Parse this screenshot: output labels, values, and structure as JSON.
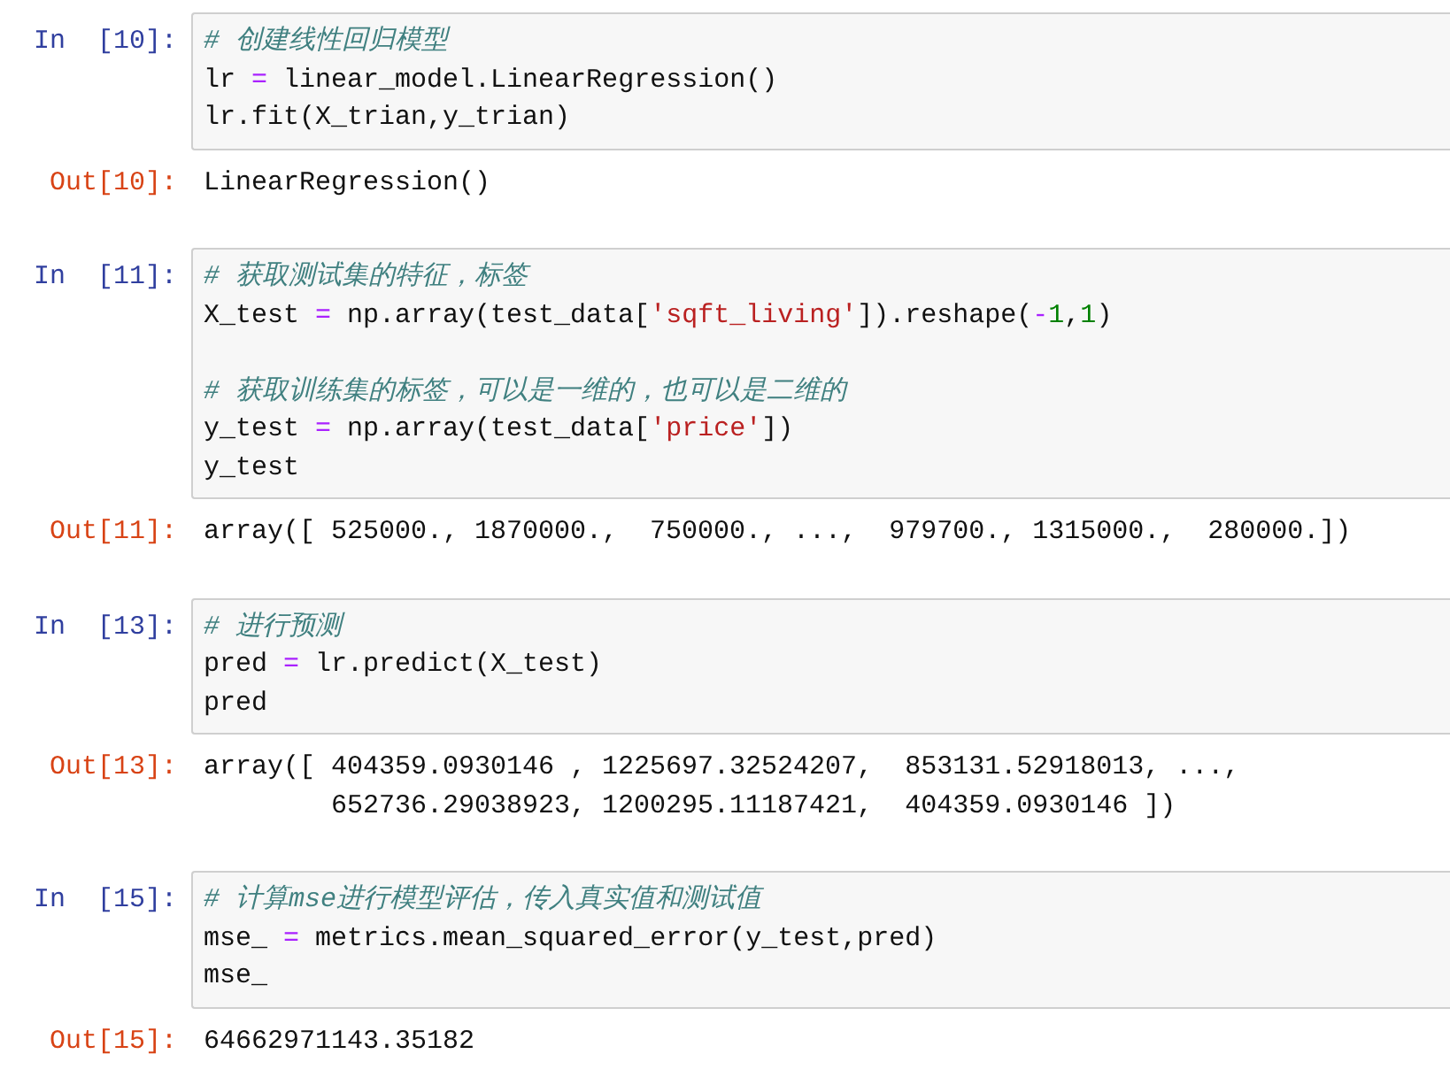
{
  "cells": [
    {
      "prompt_in": "In  [10]:",
      "lines": [
        {
          "kind": "code",
          "tokens": [
            {
              "text": "# 创建线性回归模型",
              "kind": "comment"
            }
          ]
        },
        {
          "kind": "code",
          "tokens": [
            {
              "text": "lr ",
              "kind": "plain"
            },
            {
              "text": "=",
              "kind": "operator"
            },
            {
              "text": " linear_model.LinearRegression()",
              "kind": "plain"
            }
          ]
        },
        {
          "kind": "code",
          "tokens": [
            {
              "text": "lr.fit(X_trian,y_trian)",
              "kind": "plain"
            }
          ]
        }
      ],
      "prompt_out": "Out[10]:",
      "output": [
        "LinearRegression()"
      ]
    },
    {
      "prompt_in": "In  [11]:",
      "lines": [
        {
          "kind": "code",
          "tokens": [
            {
              "text": "# 获取测试集的特征，标签",
              "kind": "comment"
            }
          ]
        },
        {
          "kind": "code",
          "tokens": [
            {
              "text": "X_test ",
              "kind": "plain"
            },
            {
              "text": "=",
              "kind": "operator"
            },
            {
              "text": " np.array(test_data[",
              "kind": "plain"
            },
            {
              "text": "'sqft_living'",
              "kind": "string"
            },
            {
              "text": "]).reshape(",
              "kind": "plain"
            },
            {
              "text": "-",
              "kind": "operator"
            },
            {
              "text": "1",
              "kind": "number"
            },
            {
              "text": ",",
              "kind": "plain"
            },
            {
              "text": "1",
              "kind": "number"
            },
            {
              "text": ")",
              "kind": "plain"
            }
          ]
        },
        {
          "kind": "blank"
        },
        {
          "kind": "code",
          "tokens": [
            {
              "text": "# 获取训练集的标签，可以是一维的，也可以是二维的",
              "kind": "comment"
            }
          ]
        },
        {
          "kind": "code",
          "tokens": [
            {
              "text": "y_test ",
              "kind": "plain"
            },
            {
              "text": "=",
              "kind": "operator"
            },
            {
              "text": " np.array(test_data[",
              "kind": "plain"
            },
            {
              "text": "'price'",
              "kind": "string"
            },
            {
              "text": "])",
              "kind": "plain"
            }
          ]
        },
        {
          "kind": "code",
          "tokens": [
            {
              "text": "y_test",
              "kind": "plain"
            }
          ]
        }
      ],
      "prompt_out": "Out[11]:",
      "output": [
        "array([ 525000., 1870000.,  750000., ...,  979700., 1315000.,  280000.])"
      ]
    },
    {
      "prompt_in": "In  [13]:",
      "lines": [
        {
          "kind": "code",
          "tokens": [
            {
              "text": "# 进行预测",
              "kind": "comment"
            }
          ]
        },
        {
          "kind": "code",
          "tokens": [
            {
              "text": "pred ",
              "kind": "plain"
            },
            {
              "text": "=",
              "kind": "operator"
            },
            {
              "text": " lr.predict(X_test)",
              "kind": "plain"
            }
          ]
        },
        {
          "kind": "code",
          "tokens": [
            {
              "text": "pred",
              "kind": "plain"
            }
          ]
        }
      ],
      "prompt_out": "Out[13]:",
      "output": [
        "array([ 404359.0930146 , 1225697.32524207,  853131.52918013, ...,",
        "        652736.29038923, 1200295.11187421,  404359.0930146 ])"
      ]
    },
    {
      "prompt_in": "In  [15]:",
      "lines": [
        {
          "kind": "code",
          "tokens": [
            {
              "text": "# 计算mse进行模型评估，传入真实值和测试值",
              "kind": "comment"
            }
          ]
        },
        {
          "kind": "code",
          "tokens": [
            {
              "text": "mse_ ",
              "kind": "plain"
            },
            {
              "text": "=",
              "kind": "operator"
            },
            {
              "text": " metrics.mean_squared_error(y_test,pred)",
              "kind": "plain"
            }
          ]
        },
        {
          "kind": "code",
          "tokens": [
            {
              "text": "mse_",
              "kind": "plain"
            }
          ]
        }
      ],
      "prompt_out": "Out[15]:",
      "output": [
        "64662971143.35182"
      ]
    }
  ]
}
